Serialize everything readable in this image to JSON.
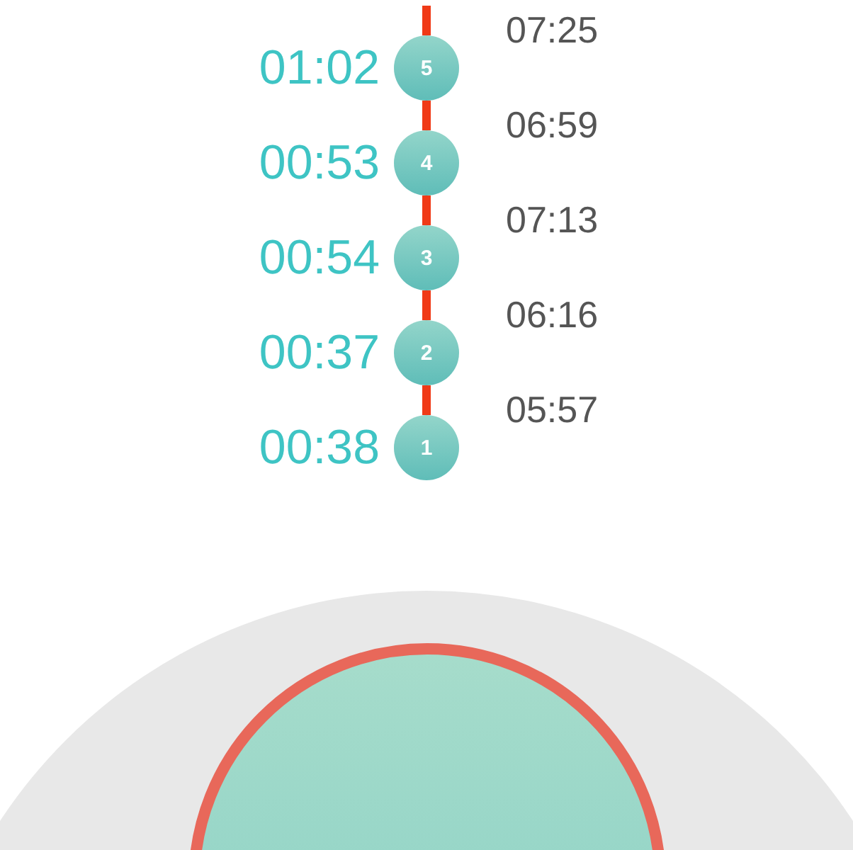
{
  "contractions": [
    {
      "number": "5",
      "duration": "01:02",
      "interval": "07:25"
    },
    {
      "number": "4",
      "duration": "00:53",
      "interval": "06:59"
    },
    {
      "number": "3",
      "duration": "00:54",
      "interval": "07:13"
    },
    {
      "number": "2",
      "duration": "00:37",
      "interval": "06:16"
    },
    {
      "number": "1",
      "duration": "00:38",
      "interval": "05:57"
    }
  ]
}
